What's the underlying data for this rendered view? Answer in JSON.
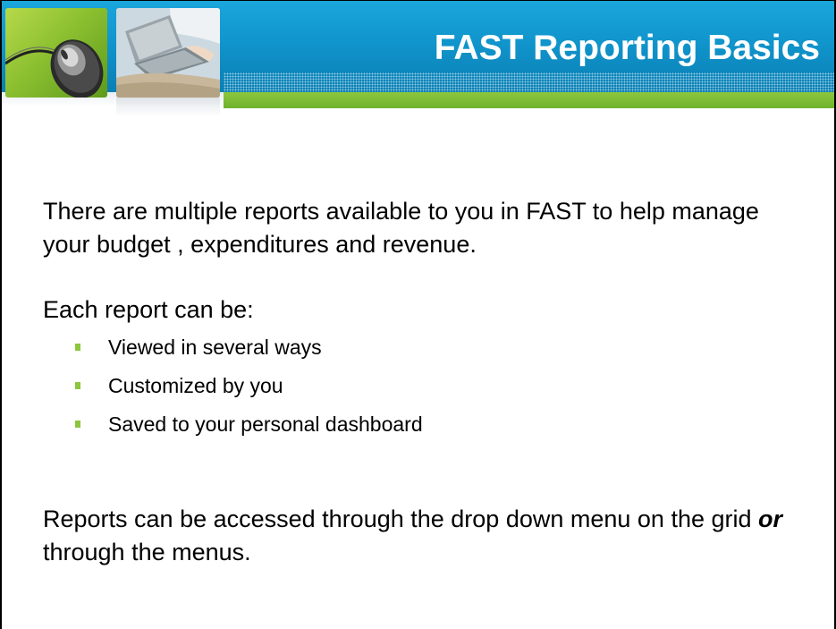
{
  "slide": {
    "title": "FAST Reporting Basics",
    "colors": {
      "header_blue": "#1095cc",
      "accent_green": "#8cc63f",
      "bullet_green": "#8cc63f",
      "text": "#000000"
    },
    "images": [
      "computer-mouse-photo",
      "laptop-on-lap-photo"
    ]
  },
  "body": {
    "intro": "There are multiple reports available to you in FAST to help manage your budget , expenditures and revenue.",
    "lead": "Each report can be:",
    "bullets": [
      {
        "text": "Viewed in several ways"
      },
      {
        "text": "Customized by you"
      },
      {
        "text": "Saved to your personal dashboard"
      }
    ],
    "closing": {
      "before": "Reports can be accessed through the drop down menu on the grid ",
      "emphasis": "or",
      "after": " through the menus."
    }
  }
}
